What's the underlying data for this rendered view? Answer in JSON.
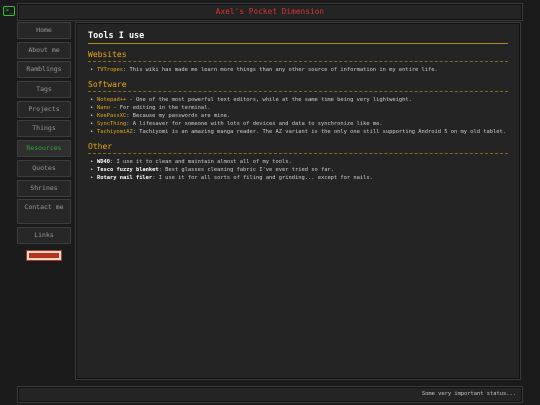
{
  "header": {
    "title": "Axel's Pocket Dimension"
  },
  "sidebar": {
    "items": [
      {
        "label": "Home"
      },
      {
        "label": "About me"
      },
      {
        "label": "Ramblings"
      },
      {
        "label": "Tags"
      },
      {
        "label": "Projects"
      },
      {
        "label": "Things"
      },
      {
        "label": "Resources"
      },
      {
        "label": "Quotes"
      },
      {
        "label": "Shrines"
      },
      {
        "label": "Contact me"
      },
      {
        "label": "Links"
      }
    ],
    "active": "Resources"
  },
  "main": {
    "title": "Tools I use",
    "sections": [
      {
        "heading": "Websites",
        "items": [
          {
            "name": "TVTropes",
            "text": ": This wiki has made me learn more things than any other source of information in my entire life."
          }
        ]
      },
      {
        "heading": "Software",
        "items": [
          {
            "name": "Notepad++",
            "text": " - One of the most powerful text editors, while at the same time being very lightweight."
          },
          {
            "name": "Nano",
            "text": " - For editing in the terminal."
          },
          {
            "name": "KeePassXC",
            "text": ": Because my passwords are mine."
          },
          {
            "name": "SyncThing",
            "text": ": A lifesaver for someone with lots of devices and data to synchronize like me."
          },
          {
            "name": "TachiyomiAZ",
            "text": ": Tachiyomi is an amazing manga reader. The AZ variant is the only one still supporting Android 5 on my old tablet."
          }
        ]
      },
      {
        "heading": "Other",
        "items": [
          {
            "name": "WD40",
            "text": ": I use it to clean and maintain almost all of my tools."
          },
          {
            "name": "Tesco fuzzy blanket",
            "text": ": Best glasses cleaning fabric I've ever tried so far."
          },
          {
            "name": "Rotary nail filer",
            "text": ": I use it for all sorts of filing and grinding... except for nails."
          }
        ]
      }
    ]
  },
  "footer": {
    "status": "Some very important status..."
  },
  "colors": {
    "accent": "#e8a915",
    "title_red": "#e0342e",
    "active_green": "#2da82d"
  },
  "icons": {
    "corner": "terminal-icon"
  }
}
